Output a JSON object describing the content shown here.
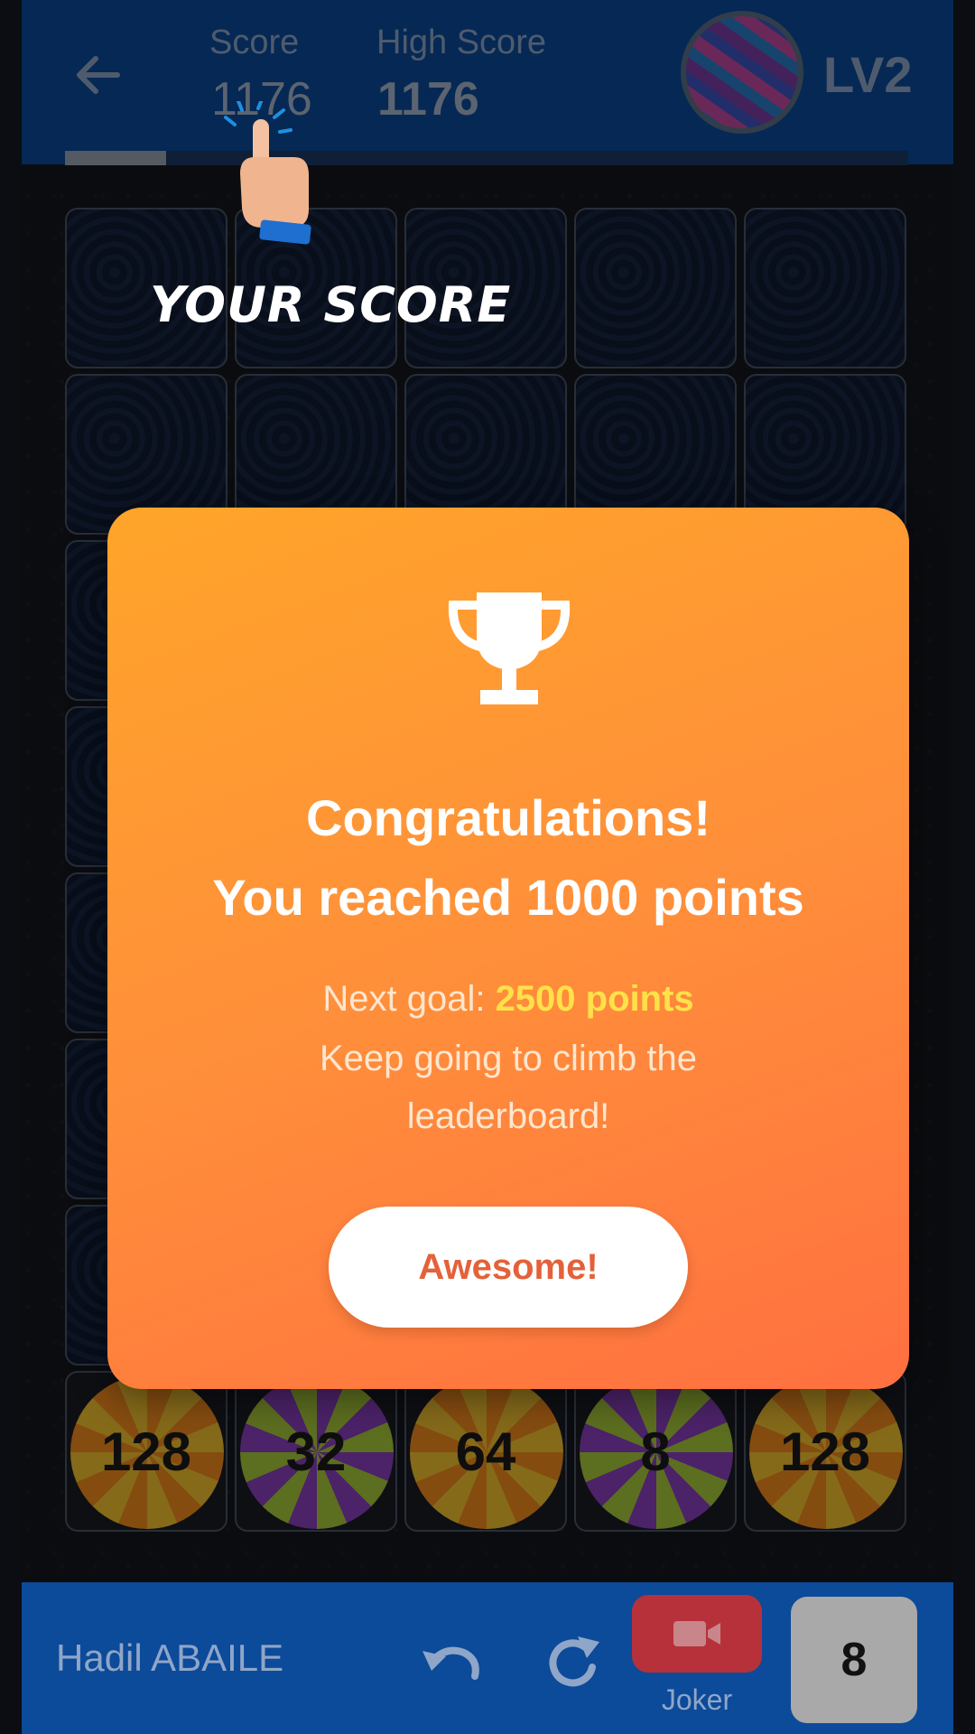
{
  "header": {
    "score_label": "Score",
    "score_value": "1176",
    "high_score_label": "High Score",
    "high_score_value": "1176",
    "level": "LV2",
    "level_progress": 0.12,
    "back_icon": "arrow-left-icon",
    "avatar_icon": "marbled-egg-avatar"
  },
  "annotation": {
    "label": "YOUR SCORE",
    "icon": "pointing-hand-icon"
  },
  "board": {
    "rows": 8,
    "cols": 5,
    "bottom_row": [
      {
        "value": "128",
        "style": "orange"
      },
      {
        "value": "32",
        "style": "purple"
      },
      {
        "value": "64",
        "style": "orange"
      },
      {
        "value": "8",
        "style": "purple"
      },
      {
        "value": "128",
        "style": "orange"
      }
    ]
  },
  "modal": {
    "icon": "trophy-icon",
    "title_line1": "Congratulations!",
    "title_line2": "You reached 1000 points",
    "next_goal_prefix": "Next goal: ",
    "next_goal_value": "2500 points",
    "message": "Keep going to climb the leaderboard!",
    "button_label": "Awesome!",
    "colors": {
      "gradient_start": "#ffa52a",
      "gradient_end": "#ff7040",
      "highlight": "#ffe14a",
      "button_text": "#e4613a"
    }
  },
  "footer": {
    "player_name": "Hadil ABAILE",
    "undo_icon": "undo-icon",
    "redo_icon": "redo-icon",
    "joker_icon": "video-camera-icon",
    "joker_label": "Joker",
    "counter_value": "8"
  },
  "colors": {
    "header_bg": "#0c4a9a",
    "board_bg": "#15171c",
    "tile_bg": "#101c33"
  }
}
